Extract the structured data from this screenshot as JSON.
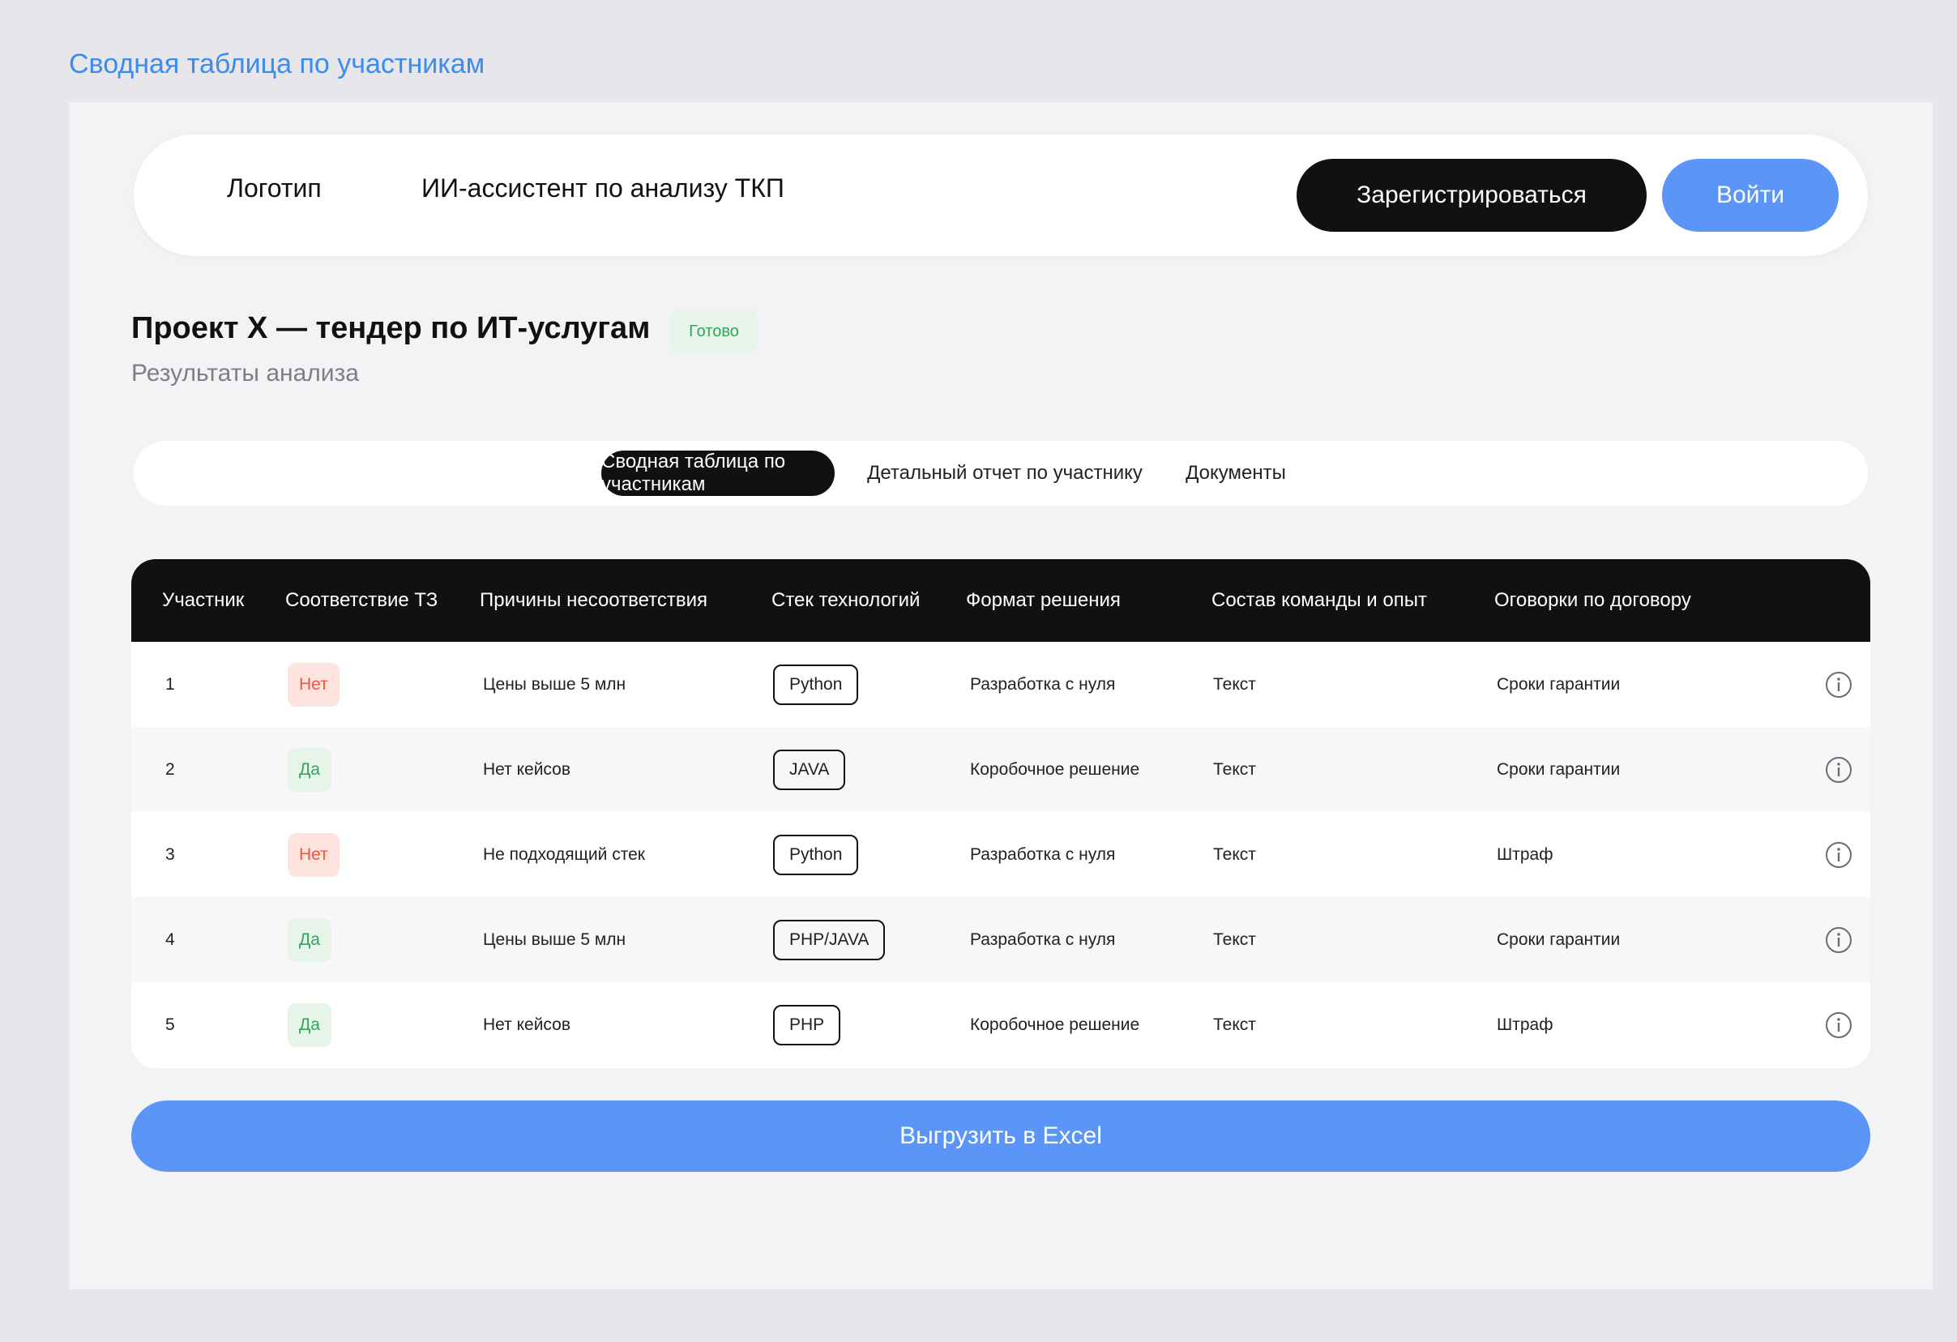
{
  "page": {
    "frame_title": "Сводная таблица по участникам"
  },
  "header": {
    "logo": "Логотип",
    "app_name": "ИИ-ассистент по анализу ТКП",
    "register_label": "Зарегистрироваться",
    "login_label": "Войти"
  },
  "project": {
    "title": "Проект X — тендер по ИТ-услугам",
    "status": "Готово",
    "subtitle": "Результаты анализа"
  },
  "tabs": [
    {
      "label": "Сводная таблица по участникам",
      "active": true
    },
    {
      "label": "Детальный отчет по участнику",
      "active": false
    },
    {
      "label": "Документы",
      "active": false
    }
  ],
  "table": {
    "headers": [
      "Участник",
      "Соответствие ТЗ",
      "Причины несоответствия",
      "Стек технологий",
      "Формат решения",
      "Состав команды и опыт",
      "Оговорки по договору"
    ],
    "rows": [
      {
        "participant": "1",
        "compliance": "Нет",
        "compliant": false,
        "reason": "Цены выше 5 млн",
        "stack": "Python",
        "format": "Разработка с нуля",
        "team": "Текст",
        "terms": "Сроки гарантии"
      },
      {
        "participant": "2",
        "compliance": "Да",
        "compliant": true,
        "reason": "Нет кейсов",
        "stack": "JAVA",
        "format": "Коробочное решение",
        "team": "Текст",
        "terms": "Сроки гарантии"
      },
      {
        "participant": "3",
        "compliance": "Нет",
        "compliant": false,
        "reason": "Не подходящий стек",
        "stack": "Python",
        "format": "Разработка с нуля",
        "team": "Текст",
        "terms": "Штраф"
      },
      {
        "participant": "4",
        "compliance": "Да",
        "compliant": true,
        "reason": "Цены выше 5 млн",
        "stack": "PHP/JAVA",
        "format": "Разработка с нуля",
        "team": "Текст",
        "terms": "Сроки гарантии"
      },
      {
        "participant": "5",
        "compliance": "Да",
        "compliant": true,
        "reason": "Нет кейсов",
        "stack": "PHP",
        "format": "Коробочное решение",
        "team": "Текст",
        "terms": "Штраф"
      }
    ]
  },
  "export": {
    "label": "Выгрузить в Excel"
  },
  "colors": {
    "accent": "#5b95f7",
    "dark": "#111113",
    "link": "#3b8cf0",
    "status_yes_bg": "#e6f4ea",
    "status_yes_text": "#35a45b",
    "status_no_bg": "#fde4df",
    "status_no_text": "#f2533f"
  },
  "icons": {
    "row_action": "info-icon"
  }
}
